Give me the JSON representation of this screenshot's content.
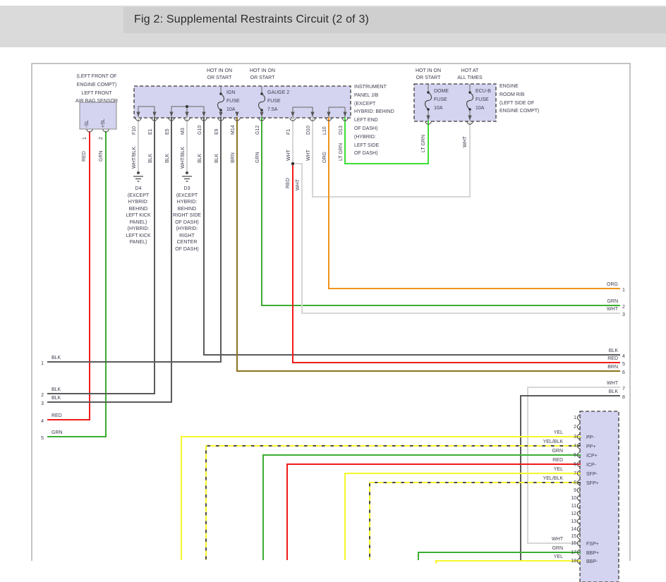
{
  "title": "Fig 2: Supplemental Restraints Circuit (2 of 3)",
  "colors": {
    "blk": "#5a5a5a",
    "wht": "#d6d6d6",
    "whtblk": "#cfcfcf",
    "red": "#ef1a1a",
    "grn": "#3aae30",
    "lt_grn": "#3ede38",
    "brn": "#8d741c",
    "org": "#f0941c",
    "yel": "#f6f62c",
    "yelblk_dash": "#4a4a4a",
    "box_fill": "#d4d4f0",
    "dash_border": "#3a3a3a",
    "solid_border": "#8a8a8a",
    "symbol": "#4a4a4a"
  },
  "sensor": {
    "location_label": "(LEFT FRONT OF\nENGINE COMPT)\nLEFT FRONT\nAIR BAG SENSOR",
    "pins": [
      {
        "num": "1",
        "name": "-SL",
        "wire": "RED"
      },
      {
        "num": "2",
        "name": "+SL",
        "wire": "GRN"
      }
    ]
  },
  "jb": {
    "name_label": "INSTRUMENT\nPANEL J/B\n(EXCEPT\nHYBRID: BEHIND\nLEFT END\nOF DASH)\n(HYBRID:\nLEFT SIDE\nOF DASH)",
    "fuses": [
      {
        "power": "HOT IN ON\nOR START",
        "label": "IGN\nFUSE\n10A"
      },
      {
        "power": "HOT IN ON\nOR START",
        "label": "GAUGE 2\nFUSE\n7.5A"
      }
    ],
    "pins": [
      {
        "id": "F10",
        "wire": "WHT/BLK"
      },
      {
        "id": "E1",
        "wire": "BLK"
      },
      {
        "id": "E5",
        "wire": "BLK"
      },
      {
        "id": "M3",
        "wire": "WHT/BLK"
      },
      {
        "id": "G10",
        "wire": "BLK"
      },
      {
        "id": "E9",
        "wire": "BLK"
      },
      {
        "id": "M14",
        "wire": "BRN"
      },
      {
        "id": "G12",
        "wire": "GRN"
      },
      {
        "id": "F1",
        "wire": "WHT"
      },
      {
        "id": "D10",
        "wire": "WHT"
      },
      {
        "id": "L10",
        "wire": "ORG"
      },
      {
        "id": "D13",
        "wire": "LT GRN"
      }
    ]
  },
  "rb": {
    "name_label": "ENGINE\nROOM R/B\n(LEFT SIDE OF\nENGINE COMPT)",
    "fuses": [
      {
        "power": "HOT IN ON\nOR START",
        "label": "DOME\nFUSE\n10A",
        "wire": "LT GRN"
      },
      {
        "power": "HOT AT\nALL TIMES",
        "label": "ECU-B\nFUSE\n10A",
        "wire": "WHT"
      }
    ]
  },
  "grounds": [
    {
      "label": "D4\n(EXCEPT\nHYBRID:\nBEHIND\nLEFT KICK\nPANEL)\n(HYBRID:\nLEFT KICK\nPANEL)"
    },
    {
      "label": "D3\n(EXCEPT\nHYBRID:\nBEHIND\nRIGHT SIDE\nOF DASH)\n(HYBRID:\nRIGHT\nCENTER\nOF DASH)"
    }
  ],
  "splice": {
    "red": "RED",
    "wht": "WHT"
  },
  "rows_left": [
    {
      "num": "1",
      "wire": "BLK"
    },
    {
      "num": "2",
      "wire": "BLK"
    },
    {
      "num": "3",
      "wire": "BLK"
    },
    {
      "num": "4",
      "wire": "RED"
    },
    {
      "num": "5",
      "wire": "GRN"
    }
  ],
  "rows_right": [
    {
      "num": "1",
      "wire": "ORG"
    },
    {
      "num": "2",
      "wire": "GRN"
    },
    {
      "num": "3",
      "wire": "WHT"
    },
    {
      "num": "4",
      "wire": "BLK"
    },
    {
      "num": "5",
      "wire": "RED"
    },
    {
      "num": "6",
      "wire": "BRN"
    },
    {
      "num": "7",
      "wire": "WHT"
    },
    {
      "num": "8",
      "wire": "BLK"
    }
  ],
  "connector": {
    "pins": [
      {
        "num": "1",
        "wire": "",
        "signal": ""
      },
      {
        "num": "2",
        "wire": "",
        "signal": ""
      },
      {
        "num": "3",
        "wire": "YEL",
        "signal": "PP-"
      },
      {
        "num": "4",
        "wire": "YEL/BLK",
        "signal": "PP+"
      },
      {
        "num": "5",
        "wire": "GRN",
        "signal": "ICP+"
      },
      {
        "num": "6",
        "wire": "RED",
        "signal": "ICP-"
      },
      {
        "num": "7",
        "wire": "YEL",
        "signal": "SFP-"
      },
      {
        "num": "8",
        "wire": "YEL/BLK",
        "signal": "SFP+"
      },
      {
        "num": "9",
        "wire": "",
        "signal": ""
      },
      {
        "num": "10",
        "wire": "",
        "signal": ""
      },
      {
        "num": "11",
        "wire": "",
        "signal": ""
      },
      {
        "num": "12",
        "wire": "",
        "signal": ""
      },
      {
        "num": "13",
        "wire": "",
        "signal": ""
      },
      {
        "num": "14",
        "wire": "",
        "signal": ""
      },
      {
        "num": "15",
        "wire": "",
        "signal": ""
      },
      {
        "num": "16",
        "wire": "WHT",
        "signal": "FSP+"
      },
      {
        "num": "17",
        "wire": "GRN",
        "signal": "BBP+"
      },
      {
        "num": "18",
        "wire": "YEL",
        "signal": "BBP-"
      }
    ]
  }
}
